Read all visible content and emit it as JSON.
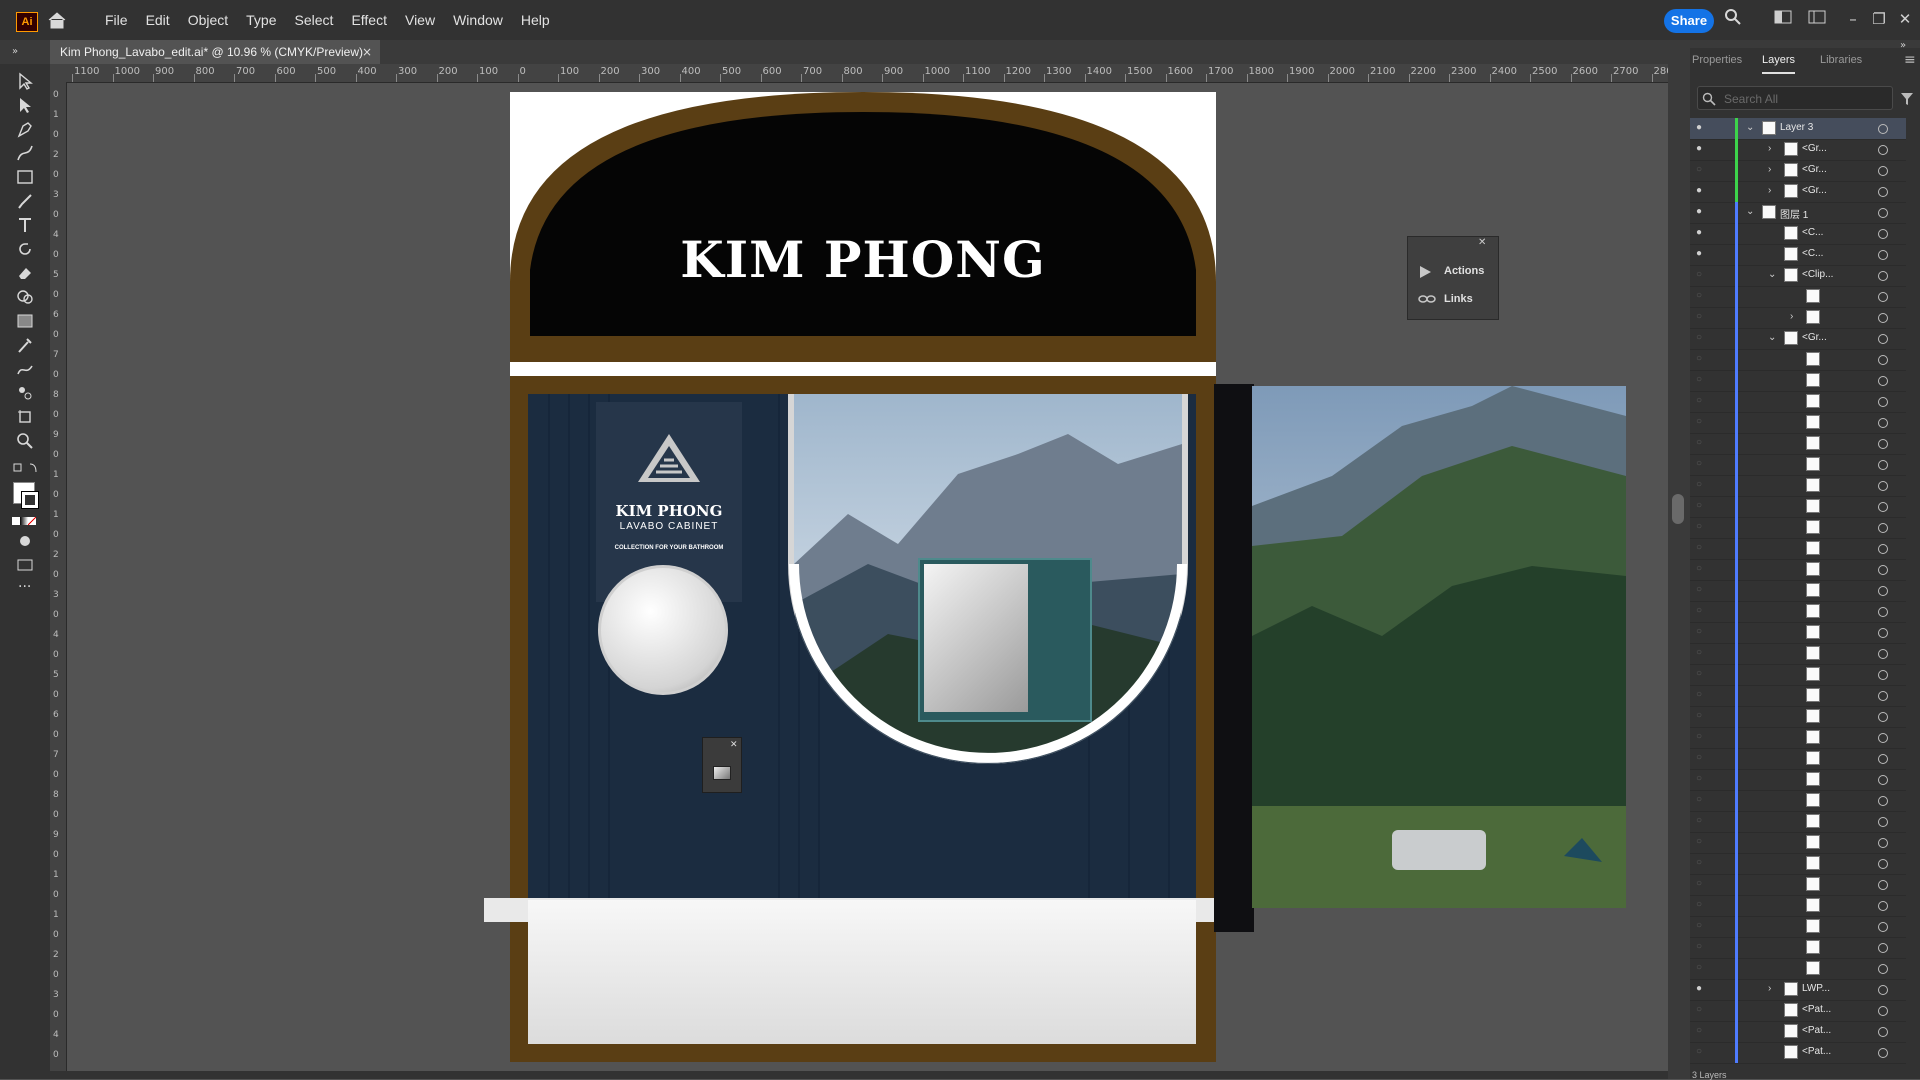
{
  "app": {
    "logo_text": "Ai"
  },
  "menu": [
    "File",
    "Edit",
    "Object",
    "Type",
    "Select",
    "Effect",
    "View",
    "Window",
    "Help"
  ],
  "share_label": "Share",
  "document_tab": {
    "title": "Kim Phong_Lavabo_edit.ai* @ 10.96 % (CMYK/Preview)",
    "close": "×"
  },
  "ruler": {
    "h_labels": [
      "1100",
      "1000",
      "900",
      "800",
      "700",
      "600",
      "500",
      "400",
      "300",
      "200",
      "100",
      "0",
      "100",
      "200",
      "300",
      "400",
      "500",
      "600",
      "700",
      "800",
      "900",
      "1000",
      "1100",
      "1200",
      "1300",
      "1400",
      "1500",
      "1600",
      "1700",
      "1800",
      "1900",
      "2000",
      "2100",
      "2200",
      "2300",
      "2400",
      "2500",
      "2600",
      "2700",
      "2800"
    ],
    "v_labels": [
      "0",
      "1",
      "0",
      "2",
      "0",
      "3",
      "0",
      "4",
      "0",
      "5",
      "0",
      "6",
      "0",
      "7",
      "0",
      "8",
      "0",
      "9",
      "0",
      "1",
      "0",
      "1",
      "0",
      "2",
      "0",
      "3",
      "0",
      "4",
      "0",
      "5",
      "0",
      "6",
      "0",
      "7",
      "0",
      "8",
      "0",
      "9",
      "0",
      "1",
      "0",
      "1",
      "0",
      "2",
      "0",
      "3",
      "0",
      "4",
      "0"
    ]
  },
  "panel_tabs": [
    "Properties",
    "Layers",
    "Libraries"
  ],
  "layers_search_placeholder": "Search All",
  "layers": [
    {
      "name": "Layer 3",
      "level": 0,
      "expanded": true,
      "visible": true,
      "color": "#3dd44b",
      "selected": true
    },
    {
      "name": "<Gr...",
      "level": 1,
      "expanded": false,
      "visible": true,
      "color": "#3dd44b"
    },
    {
      "name": "<Gr...",
      "level": 1,
      "expanded": false,
      "visible": false,
      "color": "#3dd44b"
    },
    {
      "name": "<Gr...",
      "level": 1,
      "expanded": false,
      "visible": true,
      "color": "#3dd44b"
    },
    {
      "name": "图层 1",
      "level": 0,
      "expanded": true,
      "visible": true,
      "color": "#4f7cff"
    },
    {
      "name": "<C...",
      "level": 1,
      "visible": true,
      "color": "#4f7cff"
    },
    {
      "name": "<C...",
      "level": 1,
      "visible": true,
      "color": "#4f7cff"
    },
    {
      "name": "<Clip...",
      "level": 1,
      "expanded": true,
      "visible": false,
      "color": "#4f7cff"
    },
    {
      "name": "",
      "level": 2,
      "visible": false,
      "color": "#4f7cff"
    },
    {
      "name": "",
      "level": 2,
      "expanded": false,
      "visible": false,
      "color": "#4f7cff"
    },
    {
      "name": "<Gr...",
      "level": 1,
      "expanded": true,
      "visible": false,
      "color": "#4f7cff"
    }
  ],
  "layers_footer": [
    {
      "name": "LWP...",
      "level": 1,
      "expanded": false,
      "visible": true
    },
    {
      "name": "<Pat...",
      "level": 1,
      "visible": false
    },
    {
      "name": "<Pat...",
      "level": 1,
      "visible": false
    },
    {
      "name": "<Pat...",
      "level": 1,
      "visible": false
    }
  ],
  "float_panel": {
    "items": [
      "Actions",
      "Links"
    ]
  },
  "artwork": {
    "brand_title": "KIM PHONG",
    "logo_title": "KIM PHONG",
    "logo_subtitle": "LAVABO CABINET",
    "logo_tagline": "COLLECTION FOR YOUR BATHROOM"
  },
  "status": {
    "layers_count": "3 Layers"
  },
  "colors": {
    "frame": "#5a3e14",
    "wall": "#1b2c40",
    "accent": "#1473e6",
    "layer3": "#3dd44b",
    "layer1": "#4f7cff"
  }
}
